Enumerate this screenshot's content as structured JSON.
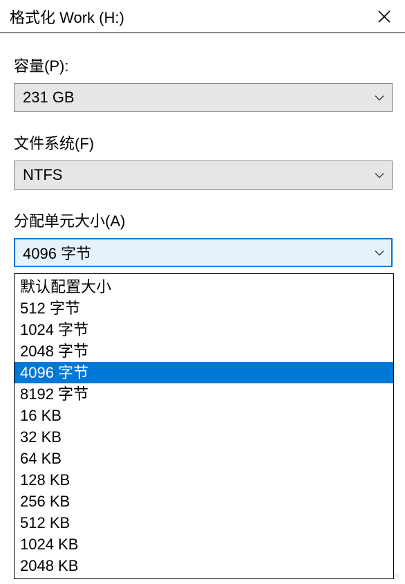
{
  "title": "格式化 Work (H:)",
  "fields": {
    "capacity": {
      "label": "容量(P):",
      "value": "231 GB"
    },
    "filesystem": {
      "label": "文件系统(F)",
      "value": "NTFS"
    },
    "allocation": {
      "label": "分配单元大小(A)",
      "value": "4096 字节"
    }
  },
  "allocation_options": [
    "默认配置大小",
    "512 字节",
    "1024 字节",
    "2048 字节",
    "4096 字节",
    "8192 字节",
    "16 KB",
    "32 KB",
    "64 KB",
    "128 KB",
    "256 KB",
    "512 KB",
    "1024 KB",
    "2048 KB"
  ],
  "allocation_selected_index": 4,
  "watermark": "www.cfan.com.cn"
}
